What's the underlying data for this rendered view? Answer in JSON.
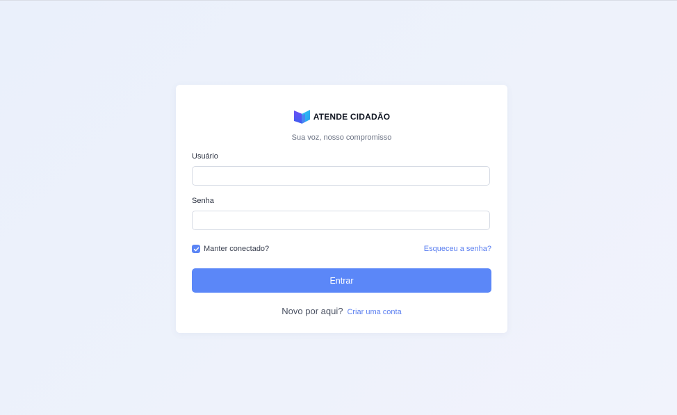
{
  "brand": {
    "name": "ATENDE CIDADÃO",
    "tagline": "Sua voz, nosso compromisso",
    "logo_icon": "book-logo-icon"
  },
  "form": {
    "username_label": "Usuário",
    "username_value": "",
    "password_label": "Senha",
    "password_value": "",
    "remember_label": "Manter conectado?",
    "remember_checked": true,
    "forgot_link": "Esqueceu a senha?",
    "submit_label": "Entrar"
  },
  "signup": {
    "prompt": "Novo por aqui?",
    "link": "Criar uma conta"
  },
  "colors": {
    "accent": "#5b87f8",
    "link": "#5b7ff0",
    "background": "#eaf0fb"
  }
}
